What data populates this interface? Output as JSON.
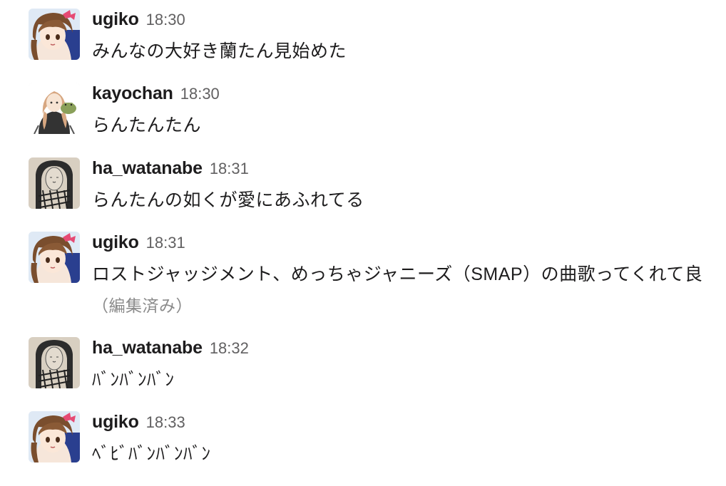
{
  "messages": [
    {
      "user": "ugiko",
      "time": "18:30",
      "text": "みんなの大好き蘭たん見始めた",
      "edited": ""
    },
    {
      "user": "kayochan",
      "time": "18:30",
      "text": "らんたんたん",
      "edited": ""
    },
    {
      "user": "ha_watanabe",
      "time": "18:31",
      "text": "らんたんの如くが愛にあふれてる",
      "edited": ""
    },
    {
      "user": "ugiko",
      "time": "18:31",
      "text": "ロストジャッジメント、めっちゃジャニーズ（SMAP）の曲歌ってくれて良",
      "edited": "（編集済み）"
    },
    {
      "user": "ha_watanabe",
      "time": "18:32",
      "text": "ﾊﾞﾝﾊﾞﾝﾊﾞﾝ",
      "edited": ""
    },
    {
      "user": "ugiko",
      "time": "18:33",
      "text": "ﾍﾞﾋﾞﾊﾞﾝﾊﾞﾝﾊﾞﾝ",
      "edited": ""
    }
  ],
  "colors": {
    "username": "#1d1c1d",
    "timestamp": "#616061",
    "edited": "#8a8a8a"
  },
  "avatars": {
    "ugiko": "anime-girl-avatar",
    "kayochan": "girl-with-frog-avatar",
    "ha_watanabe": "bald-figure-sketch-avatar"
  }
}
